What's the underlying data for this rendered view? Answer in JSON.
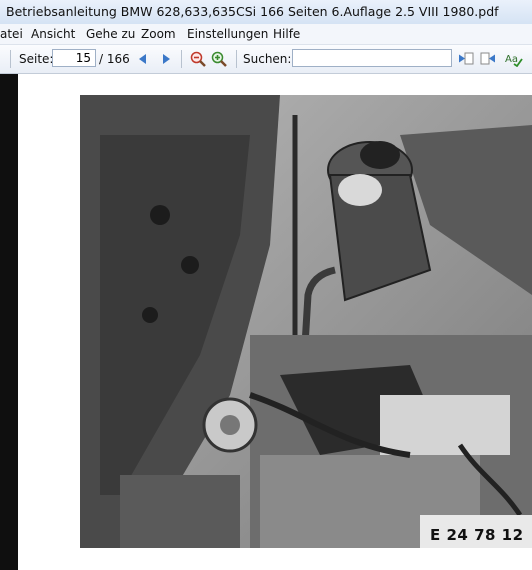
{
  "window": {
    "title": "Betriebsanleitung BMW 628,633,635CSi 166 Seiten 6.Auflage 2.5 VIII 1980.pdf"
  },
  "menu": {
    "items": [
      "atei",
      "Ansicht",
      "Gehe zu",
      "Zoom",
      "Einstellungen",
      "Hilfe"
    ]
  },
  "toolbar": {
    "page_label": "Seite:",
    "page_value": "15",
    "page_total": "/ 166",
    "search_label": "Suchen:",
    "search_value": ""
  },
  "document": {
    "photo_caption": "E 24 78 12"
  }
}
